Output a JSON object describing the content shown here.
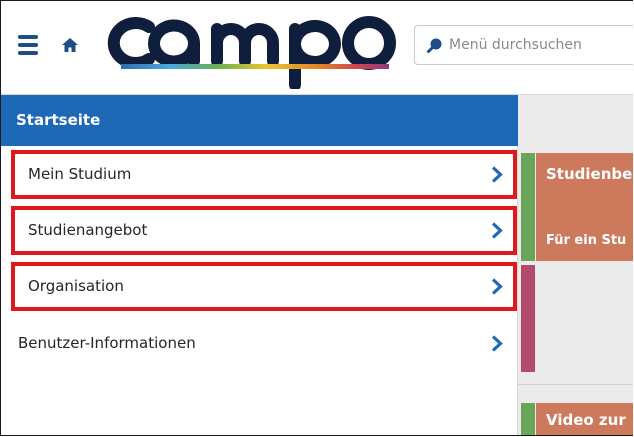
{
  "header": {
    "logo_text": "campo",
    "search_placeholder": "Menü durchsuchen",
    "menu_icon": "hamburger-menu-icon",
    "home_icon": "home-icon",
    "search_icon": "search-icon"
  },
  "sidebar": {
    "title": "Startseite",
    "items": [
      {
        "label": "Mein Studium",
        "highlighted": true
      },
      {
        "label": "Studienangebot",
        "highlighted": true
      },
      {
        "label": "Organisation",
        "highlighted": true
      },
      {
        "label": "Benutzer-Informationen",
        "highlighted": false
      }
    ]
  },
  "content": {
    "tile1": {
      "title": "Studienbe",
      "subtitle": "Für ein Stu"
    },
    "tile2": {
      "title": "Video zur"
    }
  },
  "colors": {
    "brand_blue": "#1d69b8",
    "highlight_red": "#e0181b",
    "tile_orange": "#cd7a5c",
    "strip_green": "#6aa65a",
    "strip_pink": "#b24a6b"
  }
}
